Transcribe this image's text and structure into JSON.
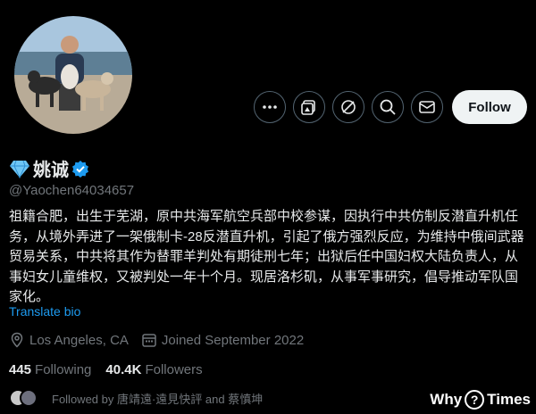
{
  "profile": {
    "name": "姚诚",
    "handle": "@Yaochen64034657",
    "bio": "祖籍合肥，出生于芜湖，原中共海军航空兵部中校参谋，因执行中共仿制反潜直升机任务，从境外弄进了一架俄制卡-28反潜直升机，引起了俄方强烈反应，为维持中俄间武器贸易关系，中共将其作为替罪羊判处有期徒刑七年；出狱后任中国妇权大陆负责人，从事妇女儿童维权，又被判处一年十个月。现居洛杉矶，从事军事研究，倡导推动军队国家化。",
    "translate_label": "Translate bio",
    "location": "Los Angeles, CA",
    "joined": "Joined September 2022",
    "following_count": "445",
    "following_label": "Following",
    "followers_count": "40.4K",
    "followers_label": "Followers",
    "followed_by": "Followed by 唐靖遠·遠見快評 and 蔡慎坤"
  },
  "actions": {
    "follow_label": "Follow",
    "icons": [
      "more-icon",
      "subscriptions-icon",
      "grok-icon",
      "search-icon",
      "message-icon"
    ]
  },
  "watermark": {
    "left": "Why",
    "mark": "?",
    "right": "Times"
  },
  "colors": {
    "accent": "#1d9bf0",
    "muted": "#71767b",
    "text": "#e7e9ea",
    "border": "#536471"
  }
}
